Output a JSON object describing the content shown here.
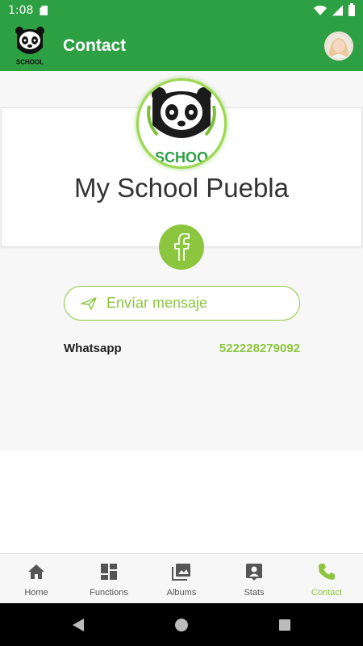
{
  "status_bar": {
    "time": "1:08"
  },
  "app_bar": {
    "title": "Contact",
    "logo_text": "SCHOOL"
  },
  "school": {
    "name": "My School Puebla",
    "logo_text": "SCHOO"
  },
  "social": {
    "facebook_icon": "facebook-icon"
  },
  "message_button": {
    "label": "Envíar mensaje",
    "icon": "send-icon"
  },
  "contact": {
    "whatsapp_label": "Whatsapp",
    "whatsapp_number": "522228279092"
  },
  "bottom_nav": {
    "items": [
      {
        "label": "Home",
        "icon": "home-icon"
      },
      {
        "label": "Functions",
        "icon": "dashboard-icon"
      },
      {
        "label": "Albums",
        "icon": "photos-icon"
      },
      {
        "label": "Stats",
        "icon": "account-box-icon"
      },
      {
        "label": "Contact",
        "icon": "phone-icon"
      }
    ],
    "active": "Contact"
  },
  "colors": {
    "primary": "#2ea044",
    "accent": "#8cc63f"
  }
}
